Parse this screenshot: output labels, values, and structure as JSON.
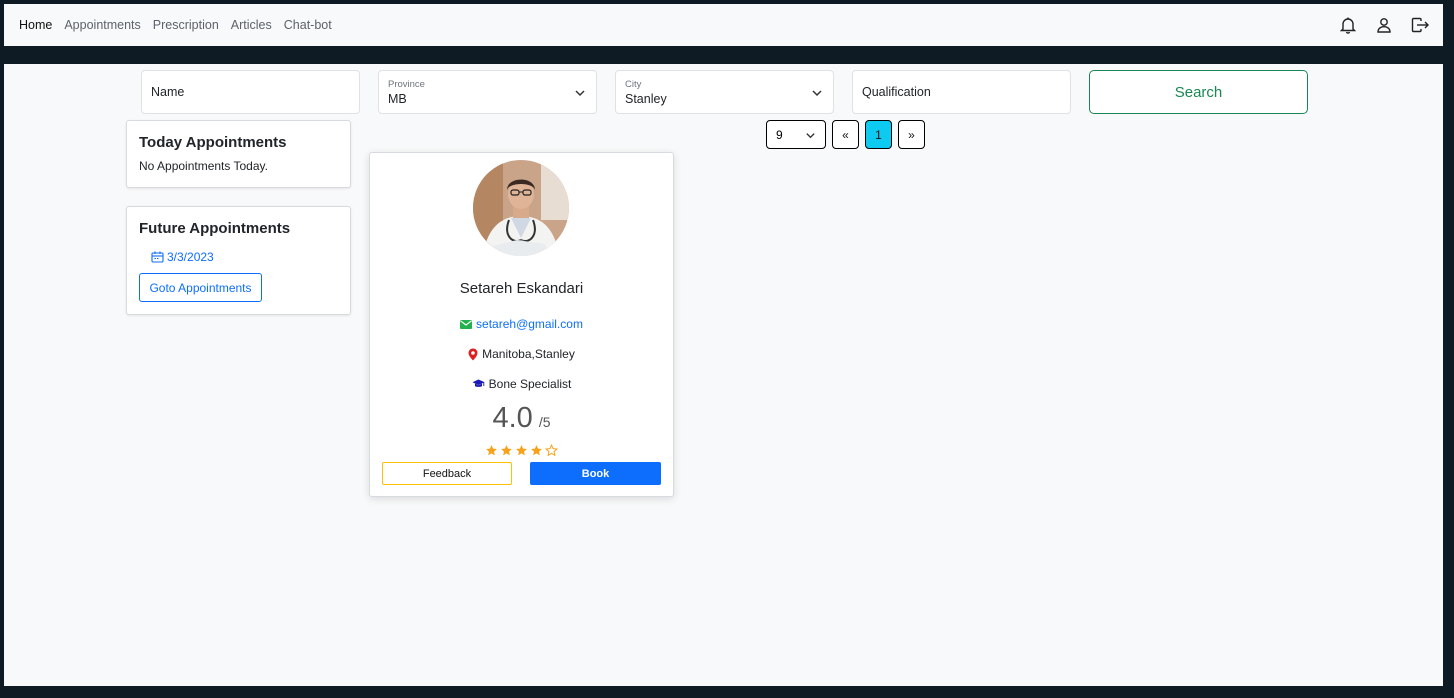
{
  "nav": {
    "links": [
      "Home",
      "Appointments",
      "Prescription",
      "Articles",
      "Chat-bot"
    ],
    "active": "Home",
    "icons": [
      "bell-icon",
      "user-icon",
      "logout-icon"
    ]
  },
  "filters": {
    "name_placeholder": "Name",
    "province_label": "Province",
    "province_value": "MB",
    "city_label": "City",
    "city_value": "Stanley",
    "qualification_placeholder": "Qualification",
    "search_label": "Search"
  },
  "pagination": {
    "per_page": "9",
    "prev": "«",
    "current": "1",
    "next": "»"
  },
  "today": {
    "title": "Today Appointments",
    "message": "No Appointments Today."
  },
  "future": {
    "title": "Future Appointments",
    "date": "3/3/2023",
    "goto_label": "Goto Appointments"
  },
  "doctor": {
    "name": "Setareh Eskandari",
    "email": "setareh@gmail.com",
    "location": "Manitoba,Stanley",
    "qualification": "Bone Specialist",
    "rating": "4.0",
    "rating_max": "/5",
    "stars_filled": 4,
    "stars_total": 5,
    "feedback_label": "Feedback",
    "book_label": "Book"
  },
  "colors": {
    "search": "#198754",
    "active_page": "#0dcaf0",
    "book": "#0d6efd",
    "feedback_border": "#ffc107",
    "star": "#f7a21b"
  }
}
